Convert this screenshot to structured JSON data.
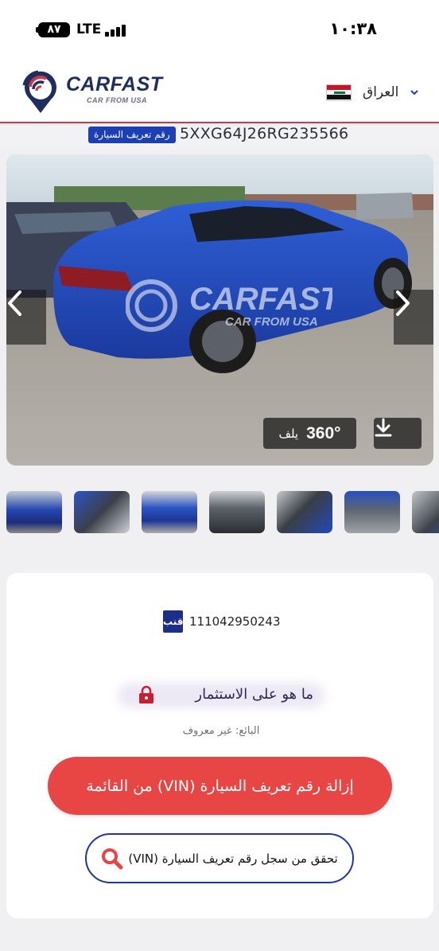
{
  "status_bar": {
    "battery": "٨٧",
    "network": "LTE",
    "time": "١٠:٣٨"
  },
  "header": {
    "logo_text": "CARFAST",
    "logo_subtitle": "CAR FROM USA",
    "country": "العراق",
    "icons": {
      "flag": "iraq-flag-icon",
      "chevron": "chevron-down-icon"
    },
    "colors": {
      "accent": "#d0364a",
      "brand_blue": "#1e2f5e"
    }
  },
  "vin_row": {
    "label": "رقم تعريف السيارة",
    "vin": "5XXG64J26RG235566"
  },
  "gallery": {
    "watermark_text": "CARFAST",
    "watermark_sub": "CAR FROM USA",
    "rotate_label": "يلف",
    "rotate_badge": "360°",
    "icons": {
      "prev": "chevron-left-icon",
      "next": "chevron-right-icon",
      "download": "download-icon",
      "rotate": "rotate-360-icon"
    }
  },
  "thumbnails": [
    "exterior-rear",
    "interior-front",
    "exterior-rear-close",
    "dashboard",
    "interior-seats",
    "engine-bay",
    "interior-side"
  ],
  "details": {
    "lot_badge": "قنب",
    "lot_number": "111042950243",
    "investment_label": "ما هو على الاستثمار",
    "seller_label": "البائع: غير معروف",
    "remove_button": "إزالة رقم تعريف السيارة (VIN) من القائمة",
    "check_button": "تحقق من سجل رقم تعريف السيارة (VIN)",
    "colors": {
      "remove_button": "#e84545",
      "check_border": "#1d35a8",
      "lock": "#c8202f"
    }
  }
}
